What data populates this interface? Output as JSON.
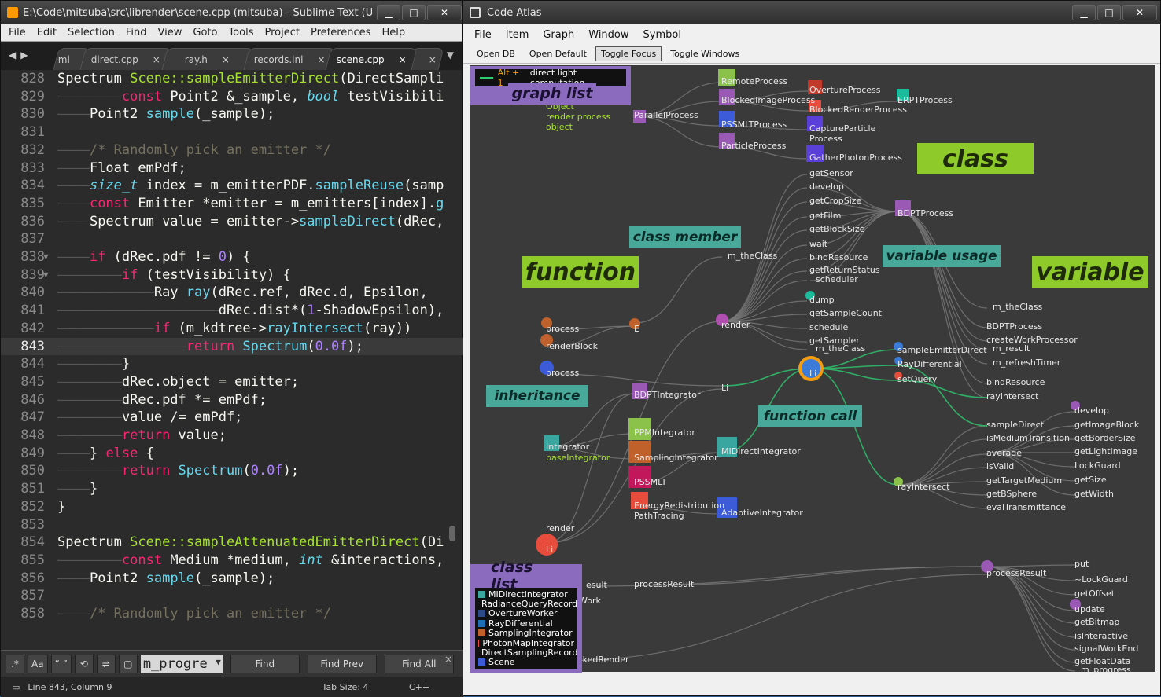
{
  "sublime": {
    "title": "E:\\Code\\mitsuba\\src\\librender\\scene.cpp (mitsuba) - Sublime Text (UNRE...",
    "menu": [
      "File",
      "Edit",
      "Selection",
      "Find",
      "View",
      "Goto",
      "Tools",
      "Project",
      "Preferences",
      "Help"
    ],
    "tabs": [
      {
        "label": "mi",
        "close": "",
        "active": false,
        "short": true
      },
      {
        "label": "direct.cpp",
        "close": "×",
        "active": false
      },
      {
        "label": "ray.h",
        "close": "×",
        "active": false
      },
      {
        "label": "records.inl",
        "close": "×",
        "active": false
      },
      {
        "label": "scene.cpp",
        "close": "×",
        "active": true
      },
      {
        "label": "",
        "close": "×",
        "active": false,
        "short": true
      }
    ],
    "code": [
      {
        "n": "828",
        "t": [
          [
            "w",
            "Spectrum "
          ],
          [
            "f",
            "Scene::sampleEmitterDirect"
          ],
          [
            "w",
            "(DirectSampli"
          ]
        ]
      },
      {
        "n": "829",
        "t": [
          [
            "g",
            "————————"
          ],
          [
            "k",
            "const "
          ],
          [
            "w",
            "Point2 &_sample, "
          ],
          [
            "i",
            "bool "
          ],
          [
            "w",
            "testVisibili"
          ]
        ]
      },
      {
        "n": "830",
        "t": [
          [
            "g",
            "————"
          ],
          [
            "w",
            "Point2 "
          ],
          [
            "fn",
            "sample"
          ],
          [
            "w",
            "(_sample);"
          ]
        ]
      },
      {
        "n": "831",
        "t": []
      },
      {
        "n": "832",
        "t": [
          [
            "g",
            "————"
          ],
          [
            "c",
            "/* Randomly pick an emitter */"
          ]
        ]
      },
      {
        "n": "833",
        "t": [
          [
            "g",
            "————"
          ],
          [
            "w",
            "Float emPdf;"
          ]
        ]
      },
      {
        "n": "834",
        "t": [
          [
            "g",
            "————"
          ],
          [
            "i",
            "size_t "
          ],
          [
            "w",
            "index = m_emitterPDF."
          ],
          [
            "fn",
            "sampleReuse"
          ],
          [
            "w",
            "(samp"
          ]
        ]
      },
      {
        "n": "835",
        "t": [
          [
            "g",
            "————"
          ],
          [
            "k",
            "const "
          ],
          [
            "w",
            "Emitter *emitter = m_emitters[index]."
          ],
          [
            "fn",
            "g"
          ]
        ]
      },
      {
        "n": "836",
        "t": [
          [
            "g",
            "————"
          ],
          [
            "w",
            "Spectrum value = emitter->"
          ],
          [
            "fn",
            "sampleDirect"
          ],
          [
            "w",
            "(dRec,"
          ]
        ]
      },
      {
        "n": "837",
        "t": []
      },
      {
        "n": "838",
        "fold": true,
        "t": [
          [
            "g",
            "————"
          ],
          [
            "k",
            "if "
          ],
          [
            "w",
            "(dRec.pdf != "
          ],
          [
            "n",
            "0"
          ],
          [
            "w",
            ") {"
          ]
        ]
      },
      {
        "n": "839",
        "fold": true,
        "t": [
          [
            "g",
            "————————"
          ],
          [
            "k",
            "if "
          ],
          [
            "w",
            "(testVisibility) {"
          ]
        ]
      },
      {
        "n": "840",
        "t": [
          [
            "g",
            "————————————"
          ],
          [
            "w",
            "Ray "
          ],
          [
            "fn",
            "ray"
          ],
          [
            "w",
            "(dRec.ref, dRec.d, Epsilon,"
          ]
        ]
      },
      {
        "n": "841",
        "t": [
          [
            "g",
            "————————————————————"
          ],
          [
            "w",
            "dRec.dist*("
          ],
          [
            "n",
            "1"
          ],
          [
            "w",
            "-ShadowEpsilon),"
          ]
        ]
      },
      {
        "n": "842",
        "t": [
          [
            "g",
            "————————————"
          ],
          [
            "k",
            "if "
          ],
          [
            "w",
            "(m_kdtree->"
          ],
          [
            "fn",
            "rayIntersect"
          ],
          [
            "w",
            "(ray))"
          ]
        ]
      },
      {
        "n": "843",
        "cur": true,
        "t": [
          [
            "g",
            "————————————————"
          ],
          [
            "k",
            "return "
          ],
          [
            "fn",
            "Spectrum"
          ],
          [
            "w",
            "("
          ],
          [
            "n",
            "0.0f"
          ],
          [
            "w",
            ");"
          ]
        ]
      },
      {
        "n": "844",
        "t": [
          [
            "g",
            "————————"
          ],
          [
            "w",
            "}"
          ]
        ]
      },
      {
        "n": "845",
        "t": [
          [
            "g",
            "————————"
          ],
          [
            "w",
            "dRec.object = emitter;"
          ]
        ]
      },
      {
        "n": "846",
        "t": [
          [
            "g",
            "————————"
          ],
          [
            "w",
            "dRec.pdf *= emPdf;"
          ]
        ]
      },
      {
        "n": "847",
        "t": [
          [
            "g",
            "————————"
          ],
          [
            "w",
            "value /= emPdf;"
          ]
        ]
      },
      {
        "n": "848",
        "t": [
          [
            "g",
            "————————"
          ],
          [
            "k",
            "return "
          ],
          [
            "w",
            "value;"
          ]
        ]
      },
      {
        "n": "849",
        "t": [
          [
            "g",
            "————"
          ],
          [
            "w",
            "} "
          ],
          [
            "k",
            "else "
          ],
          [
            "w",
            "{"
          ]
        ]
      },
      {
        "n": "850",
        "t": [
          [
            "g",
            "————————"
          ],
          [
            "k",
            "return "
          ],
          [
            "fn",
            "Spectrum"
          ],
          [
            "w",
            "("
          ],
          [
            "n",
            "0.0f"
          ],
          [
            "w",
            ");"
          ]
        ]
      },
      {
        "n": "851",
        "t": [
          [
            "g",
            "————"
          ],
          [
            "w",
            "}"
          ]
        ]
      },
      {
        "n": "852",
        "t": [
          [
            "w",
            "}"
          ]
        ]
      },
      {
        "n": "853",
        "t": []
      },
      {
        "n": "854",
        "t": [
          [
            "w",
            "Spectrum "
          ],
          [
            "f",
            "Scene::sampleAttenuatedEmitterDirect"
          ],
          [
            "w",
            "(Di"
          ]
        ]
      },
      {
        "n": "855",
        "t": [
          [
            "g",
            "————————"
          ],
          [
            "k",
            "const "
          ],
          [
            "w",
            "Medium *medium, "
          ],
          [
            "i",
            "int "
          ],
          [
            "w",
            "&interactions,"
          ]
        ]
      },
      {
        "n": "856",
        "t": [
          [
            "g",
            "————"
          ],
          [
            "w",
            "Point2 "
          ],
          [
            "fn",
            "sample"
          ],
          [
            "w",
            "(_sample);"
          ]
        ]
      },
      {
        "n": "857",
        "t": []
      },
      {
        "n": "858",
        "t": [
          [
            "g",
            "————"
          ],
          [
            "c",
            "/* Randomly pick an emitter */"
          ]
        ]
      }
    ],
    "find": {
      "opt_labels": [
        ".*",
        "Aa",
        "“ ”",
        "⟲",
        "⇌",
        "▢"
      ],
      "value": "m_progre",
      "find_label": "Find",
      "find_prev_label": "Find Prev",
      "find_all_label": "Find All",
      "close": "×"
    },
    "status": {
      "position": "Line 843, Column 9",
      "tab_size": "Tab Size: 4",
      "syntax": "C++"
    }
  },
  "atlas": {
    "title": "Code Atlas",
    "menu": [
      "File",
      "Item",
      "Graph",
      "Window",
      "Symbol"
    ],
    "toolbar": [
      "Open DB",
      "Open Default",
      "Toggle Focus",
      "Toggle Windows"
    ],
    "graph_list": {
      "label": "graph list",
      "entry_key": "Alt + 1",
      "entry_text": "direct light computation"
    },
    "class_list": {
      "label": "class list",
      "items": [
        {
          "name": "MIDirectIntegrator",
          "color": "#3aa6a0"
        },
        {
          "name": "RadianceQueryRecord",
          "color": "#4caf50"
        },
        {
          "name": "OvertureWorker",
          "color": "#2c4a8a"
        },
        {
          "name": "RayDifferential",
          "color": "#1e6fb8"
        },
        {
          "name": "SamplingIntegrator",
          "color": "#c0602a"
        },
        {
          "name": "PhotonMapIntegrator",
          "color": "#e74c3c"
        },
        {
          "name": "DirectSamplingRecord",
          "color": "#d64541"
        },
        {
          "name": "Scene",
          "color": "#3b5bd9"
        }
      ]
    },
    "callouts": {
      "class": "class",
      "function": "function",
      "class_member": "class member",
      "variable_usage": "variable usage",
      "variable": "variable",
      "inheritance": "inheritance",
      "function_call": "function call"
    },
    "nodes": [
      [
        "ParallelProcess",
        806,
        147
      ],
      [
        "RemoteProcess",
        917,
        104
      ],
      [
        "BlockedImageProcess",
        917,
        128
      ],
      [
        "OvertureProcess",
        1029,
        115
      ],
      [
        "BlockedRenderProcess",
        1029,
        140
      ],
      [
        "ERPTProcess",
        1141,
        128
      ],
      [
        "PSSMLTProcess",
        917,
        159
      ],
      [
        "CaptureParticle",
        1029,
        164
      ],
      [
        "Process",
        1029,
        177
      ],
      [
        "ParticleProcess",
        917,
        186
      ],
      [
        "GatherPhotonProcess",
        1029,
        201
      ],
      [
        "BDPTProcess",
        1141,
        272
      ],
      [
        "getSensor",
        1029,
        221
      ],
      [
        "develop",
        1029,
        238
      ],
      [
        "getCropSize",
        1029,
        256
      ],
      [
        "getFilm",
        1029,
        275
      ],
      [
        "getBlockSize",
        1029,
        292
      ],
      [
        "wait",
        1029,
        311
      ],
      [
        "bindResource",
        1029,
        328
      ],
      [
        "getReturnStatus",
        1029,
        344
      ],
      [
        "scheduler",
        1037,
        356
      ],
      [
        "m_theClass",
        925,
        326
      ],
      [
        "dump",
        1029,
        382
      ],
      [
        "getSampleCount",
        1029,
        399
      ],
      [
        "schedule",
        1029,
        417
      ],
      [
        "getSampler",
        1029,
        434
      ],
      [
        "m_theClass",
        1037,
        444
      ],
      [
        "process",
        694,
        419
      ],
      [
        "renderBlock",
        694,
        441
      ],
      [
        "E",
        806,
        419
      ],
      [
        "render",
        917,
        414
      ],
      [
        "process",
        694,
        475
      ],
      [
        "Li",
        917,
        494
      ],
      [
        "Li",
        1029,
        476
      ],
      [
        "sampleEmitterDirect",
        1141,
        446
      ],
      [
        "RayDifferential",
        1141,
        464
      ],
      [
        "setQuery",
        1141,
        483
      ],
      [
        "BDPTIntegrator",
        806,
        503
      ],
      [
        "Integrator",
        694,
        569
      ],
      [
        "baseIntegrator",
        694,
        583
      ],
      [
        "PPMIntegrator",
        806,
        551
      ],
      [
        "SamplingIntegrator",
        806,
        583
      ],
      [
        "MIDirectIntegrator",
        917,
        575
      ],
      [
        "PSSMLT",
        806,
        614
      ],
      [
        "EnergyRedistribution",
        806,
        644
      ],
      [
        "PathTracing",
        806,
        657
      ],
      [
        "AdaptiveIntegrator",
        917,
        653
      ],
      [
        "render",
        694,
        673
      ],
      [
        "Li",
        694,
        700
      ],
      [
        "rayIntersect",
        1141,
        620
      ],
      [
        "m_theClass",
        1262,
        391
      ],
      [
        "BDPTProcess",
        1254,
        416
      ],
      [
        "createWorkProcessor",
        1254,
        433
      ],
      [
        "m_result",
        1262,
        444
      ],
      [
        "m_refreshTimer",
        1262,
        462
      ],
      [
        "bindResource",
        1254,
        487
      ],
      [
        "rayIntersect",
        1254,
        505
      ],
      [
        "sampleDirect",
        1254,
        541
      ],
      [
        "isMediumTransition",
        1254,
        558
      ],
      [
        "average",
        1254,
        577
      ],
      [
        "isValid",
        1254,
        594
      ],
      [
        "getTargetMedium",
        1254,
        612
      ],
      [
        "getBSphere",
        1254,
        629
      ],
      [
        "evalTransmittance",
        1254,
        646
      ],
      [
        "develop",
        1366,
        523
      ],
      [
        "getImageBlock",
        1366,
        541
      ],
      [
        "getBorderSize",
        1366,
        558
      ],
      [
        "getLightImage",
        1366,
        575
      ],
      [
        "LockGuard",
        1366,
        593
      ],
      [
        "getSize",
        1366,
        611
      ],
      [
        "getWidth",
        1366,
        629
      ],
      [
        "processResult",
        1254,
        730
      ],
      [
        "processResult",
        806,
        744
      ],
      [
        "put",
        1366,
        718
      ],
      [
        "~LockGuard",
        1366,
        738
      ],
      [
        "getOffset",
        1366,
        756
      ],
      [
        "update",
        1366,
        776
      ],
      [
        "getBitmap",
        1366,
        792
      ],
      [
        "isInteractive",
        1366,
        810
      ],
      [
        "signalWorkEnd",
        1366,
        826
      ],
      [
        "getFloatData",
        1366,
        842
      ],
      [
        "m_progress",
        1374,
        853
      ],
      [
        "~BlockedRender",
        708,
        840
      ],
      [
        "esult",
        745,
        745
      ],
      [
        "Work",
        736,
        765
      ],
      [
        "Object",
        694,
        136
      ],
      [
        "render process",
        694,
        149
      ],
      [
        "object",
        694,
        162
      ]
    ]
  }
}
